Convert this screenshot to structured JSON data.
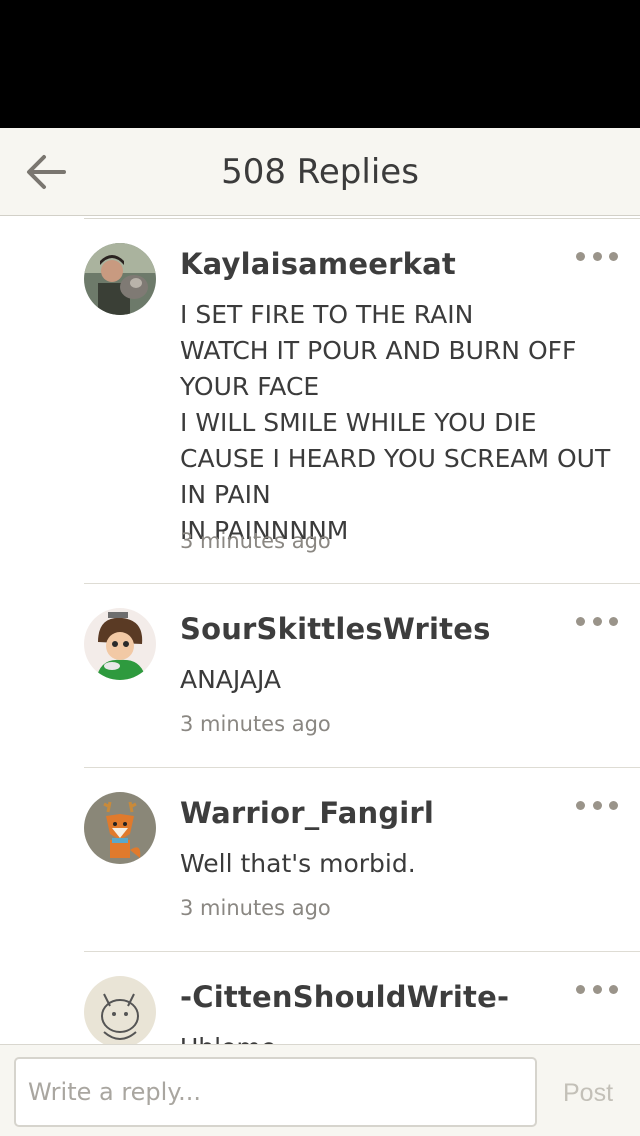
{
  "header": {
    "title": "508 Replies",
    "back_icon": "arrow-left-icon"
  },
  "comments": [
    {
      "username": "Kaylaisameerkat",
      "text": "I SET FIRE TO THE RAIN\nWATCH IT POUR AND BURN OFF YOUR FACE\nI WILL SMILE WHILE YOU DIE CAUSE I HEARD YOU SCREAM OUT IN PAIN\nIN PAINNNNM",
      "timestamp": "3 minutes ago"
    },
    {
      "username": "SourSkittlesWrites",
      "text": "ANAJAJA",
      "timestamp": "3 minutes ago"
    },
    {
      "username": "Warrior_Fangirl",
      "text": "Well that's morbid.",
      "timestamp": "3 minutes ago"
    },
    {
      "username": "-CittenShouldWrite-",
      "text": "Uhlome",
      "timestamp": ""
    }
  ],
  "reply_bar": {
    "placeholder": "Write a reply...",
    "post_label": "Post"
  },
  "colors": {
    "header_bg": "#f7f6f1",
    "text": "#3b3b3b",
    "muted": "#8a8782",
    "post_disabled": "#c3c0b8"
  }
}
